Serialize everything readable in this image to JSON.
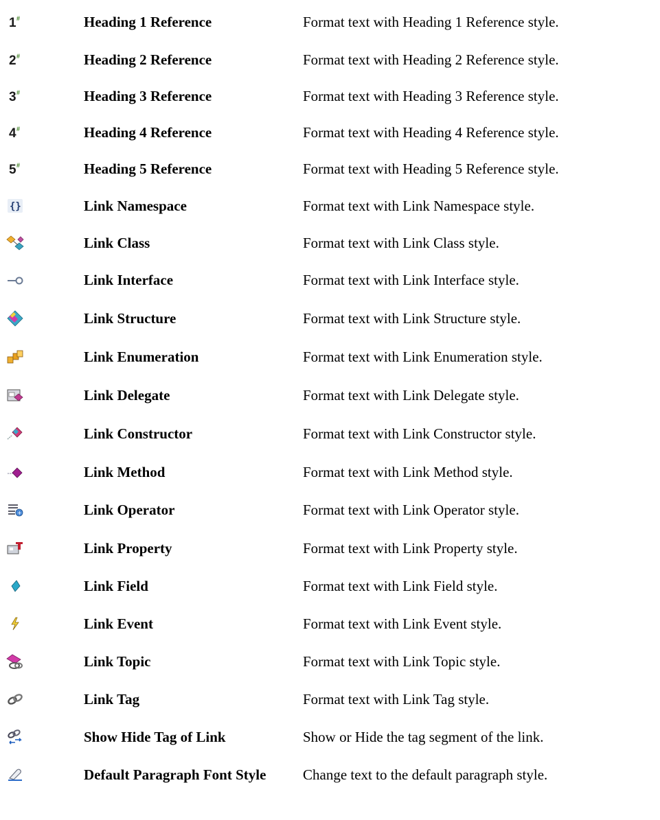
{
  "rows": [
    {
      "icon": "heading-1-icon",
      "name": "Heading 1 Reference",
      "desc": "Format text with Heading 1 Reference style."
    },
    {
      "icon": "heading-2-icon",
      "name": "Heading 2 Reference",
      "desc": "Format text with Heading 2 Reference style."
    },
    {
      "icon": "heading-3-icon",
      "name": "Heading 3 Reference",
      "desc": "Format text with Heading 3 Reference style."
    },
    {
      "icon": "heading-4-icon",
      "name": "Heading 4 Reference",
      "desc": "Format text with Heading 4 Reference style."
    },
    {
      "icon": "heading-5-icon",
      "name": "Heading 5 Reference",
      "desc": "Format text with Heading 5 Reference style."
    },
    {
      "icon": "namespace-icon",
      "name": "Link Namespace",
      "desc": "Format text with Link Namespace style."
    },
    {
      "icon": "class-icon",
      "name": "Link Class",
      "desc": "Format text with Link Class style."
    },
    {
      "icon": "interface-icon",
      "name": "Link Interface",
      "desc": "Format text with Link Interface style."
    },
    {
      "icon": "structure-icon",
      "name": "Link Structure",
      "desc": "Format text with Link Structure style."
    },
    {
      "icon": "enumeration-icon",
      "name": "Link Enumeration",
      "desc": "Format text with Link Enumeration style."
    },
    {
      "icon": "delegate-icon",
      "name": "Link Delegate",
      "desc": "Format text with Link Delegate style."
    },
    {
      "icon": "constructor-icon",
      "name": "Link Constructor",
      "desc": "Format text with Link Constructor style."
    },
    {
      "icon": "method-icon",
      "name": "Link Method",
      "desc": "Format text with Link Method style."
    },
    {
      "icon": "operator-icon",
      "name": "Link Operator",
      "desc": "Format text with Link Operator style."
    },
    {
      "icon": "property-icon",
      "name": "Link Property",
      "desc": "Format text with Link Property style."
    },
    {
      "icon": "field-icon",
      "name": "Link Field",
      "desc": "Format text with Link Field style."
    },
    {
      "icon": "event-icon",
      "name": "Link Event",
      "desc": "Format text with Link Event style."
    },
    {
      "icon": "topic-icon",
      "name": "Link Topic",
      "desc": "Format text with Link Topic style."
    },
    {
      "icon": "tag-icon",
      "name": "Link Tag",
      "desc": "Format text with Link Tag style."
    },
    {
      "icon": "show-hide-tag-icon",
      "name": "Show Hide Tag of Link",
      "desc": "Show or Hide the tag segment of the link."
    },
    {
      "icon": "eraser-icon",
      "name": "Default Paragraph Font Style",
      "desc": "Change text to the default paragraph style."
    }
  ]
}
